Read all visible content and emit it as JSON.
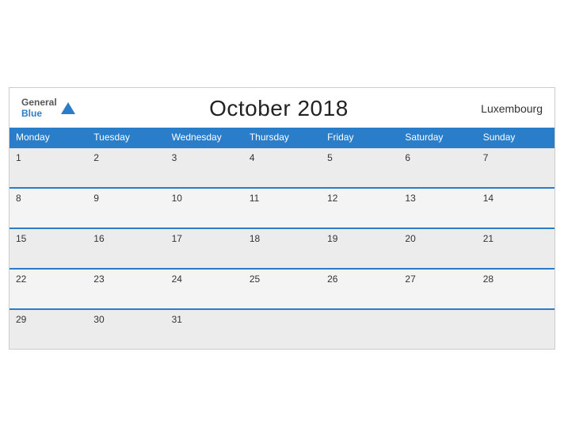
{
  "header": {
    "logo_general": "General",
    "logo_blue": "Blue",
    "month_title": "October 2018",
    "country": "Luxembourg"
  },
  "days_of_week": [
    "Monday",
    "Tuesday",
    "Wednesday",
    "Thursday",
    "Friday",
    "Saturday",
    "Sunday"
  ],
  "weeks": [
    [
      "1",
      "2",
      "3",
      "4",
      "5",
      "6",
      "7"
    ],
    [
      "8",
      "9",
      "10",
      "11",
      "12",
      "13",
      "14"
    ],
    [
      "15",
      "16",
      "17",
      "18",
      "19",
      "20",
      "21"
    ],
    [
      "22",
      "23",
      "24",
      "25",
      "26",
      "27",
      "28"
    ],
    [
      "29",
      "30",
      "31",
      "",
      "",
      "",
      ""
    ]
  ],
  "colors": {
    "header_bg": "#2a7dc9",
    "row_odd": "#f4f4f4",
    "row_even": "#ececec",
    "border": "#2a7dc9"
  }
}
